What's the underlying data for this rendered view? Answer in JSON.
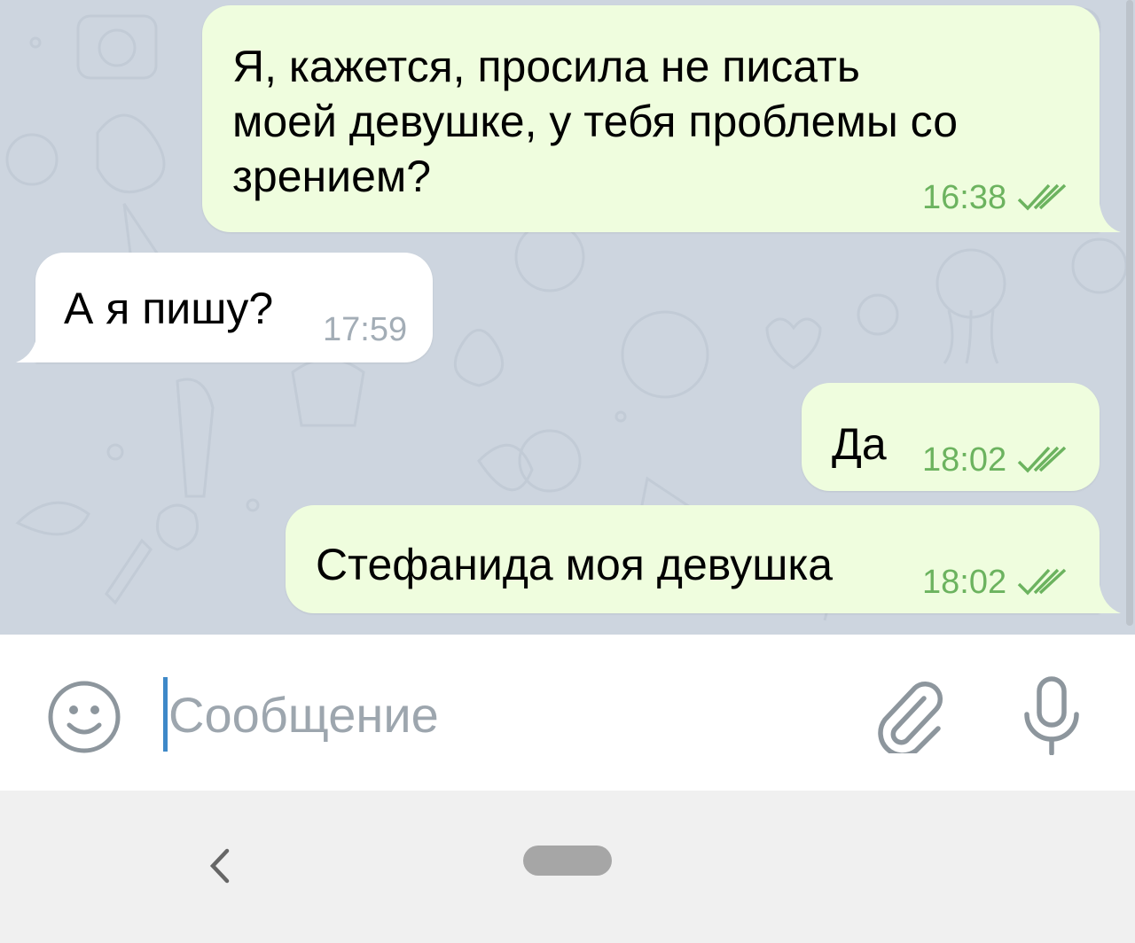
{
  "messages": [
    {
      "direction": "out",
      "text": "Я, кажется, просила не писать\nмоей девушке, у тебя проблемы со\nзрением?",
      "time": "16:38",
      "status": "read"
    },
    {
      "direction": "in",
      "text": "А я пишу?",
      "time": "17:59"
    },
    {
      "direction": "out",
      "text": "Да",
      "time": "18:02",
      "status": "read"
    },
    {
      "direction": "out",
      "text": "Стефанида моя девушка",
      "time": "18:02",
      "status": "read"
    }
  ],
  "composer": {
    "placeholder": "Сообщение",
    "emoji_icon": "smiley-icon",
    "attach_icon": "paperclip-icon",
    "mic_icon": "microphone-icon"
  },
  "navigation": {
    "back_icon": "chevron-left-icon",
    "home_icon": "home-pill-icon"
  },
  "colors": {
    "chat_background": "#cdd5df",
    "outgoing_bubble": "#effdde",
    "incoming_bubble": "#ffffff",
    "outgoing_time": "#6cb35f",
    "incoming_time": "#a3adb6",
    "caret": "#3e88c8",
    "icon_gray": "#8d969d"
  }
}
